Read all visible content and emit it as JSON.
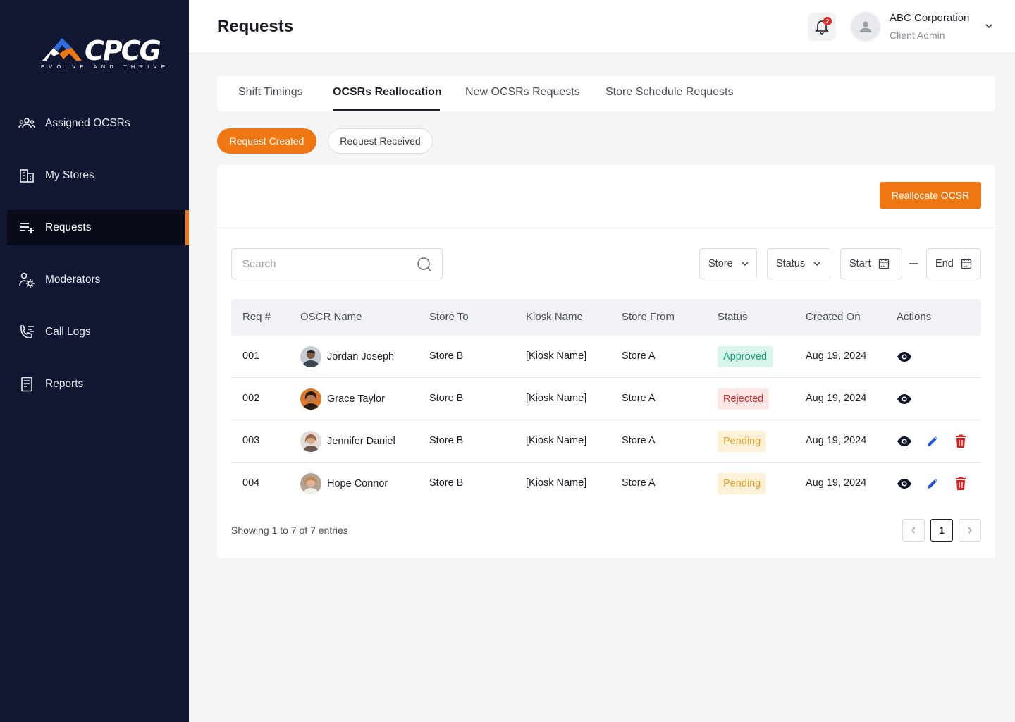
{
  "brand": {
    "logo_text": "CPCG",
    "tagline": "EVOLVE AND THRIVE",
    "accent": "#ee7712",
    "sidebar_bg": "#111732"
  },
  "sidebar": {
    "items": [
      {
        "label": "Assigned OCSRs",
        "icon": "users-icon",
        "active": false
      },
      {
        "label": "My Stores",
        "icon": "building-icon",
        "active": false
      },
      {
        "label": "Requests",
        "icon": "list-add-icon",
        "active": true
      },
      {
        "label": "Moderators",
        "icon": "user-gear-icon",
        "active": false
      },
      {
        "label": "Call Logs",
        "icon": "phone-list-icon",
        "active": false
      },
      {
        "label": "Reports",
        "icon": "document-icon",
        "active": false
      }
    ]
  },
  "header": {
    "title": "Requests",
    "notification_count": "2",
    "company": "ABC Corporation",
    "role": "Client Admin"
  },
  "tabs": [
    {
      "label": "Shift Timings",
      "active": false
    },
    {
      "label": "OCSRs Reallocation",
      "active": true
    },
    {
      "label": "New OCSRs Requests",
      "active": false
    },
    {
      "label": "Store Schedule Requests",
      "active": false
    }
  ],
  "pills": {
    "created": "Request Created",
    "received": "Request Received"
  },
  "toolbar": {
    "reallocate_label": "Reallocate OCSR"
  },
  "filters": {
    "search_placeholder": "Search",
    "store": "Store",
    "status": "Status",
    "start": "Start",
    "end": "End"
  },
  "table": {
    "headers": [
      "Req #",
      "OSCR Name",
      "Store To",
      "Kiosk Name",
      "Store From",
      "Status",
      "Created On",
      "Actions"
    ],
    "rows": [
      {
        "req": "001",
        "name": "Jordan Joseph",
        "store_to": "Store B",
        "kiosk": "[Kiosk Name]",
        "store_from": "Store A",
        "status": "Approved",
        "created": "Aug 19, 2024"
      },
      {
        "req": "002",
        "name": "Grace Taylor",
        "store_to": "Store B",
        "kiosk": "[Kiosk Name]",
        "store_from": "Store A",
        "status": "Rejected",
        "created": "Aug 19, 2024"
      },
      {
        "req": "003",
        "name": "Jennifer Daniel",
        "store_to": "Store B",
        "kiosk": "[Kiosk Name]",
        "store_from": "Store A",
        "status": "Pending",
        "created": "Aug 19, 2024"
      },
      {
        "req": "004",
        "name": "Hope Connor",
        "store_to": "Store B",
        "kiosk": "[Kiosk Name]",
        "store_from": "Store A",
        "status": "Pending",
        "created": "Aug 19, 2024"
      }
    ]
  },
  "footer": {
    "showing": "Showing 1 to 7 of 7 entries",
    "current_page": "1"
  },
  "status_colors": {
    "approved": "#1a9e6f",
    "rejected": "#d02b2b",
    "pending": "#e0a123"
  }
}
